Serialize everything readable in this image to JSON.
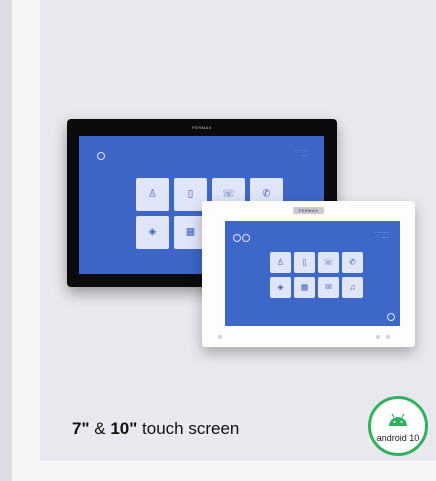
{
  "product": {
    "brand_7": "FERMAX",
    "brand_10": "FERMAX",
    "caption": {
      "size_a": "7\"",
      "and": " & ",
      "size_b": "10\"",
      "rest": " touch screen"
    },
    "badge": {
      "label": "android 10",
      "icon": "android-robot-icon",
      "accent": "#2fb35a"
    }
  },
  "colors": {
    "screen_blue": "#3e66c9",
    "card_bg": "#e8e8ee"
  }
}
